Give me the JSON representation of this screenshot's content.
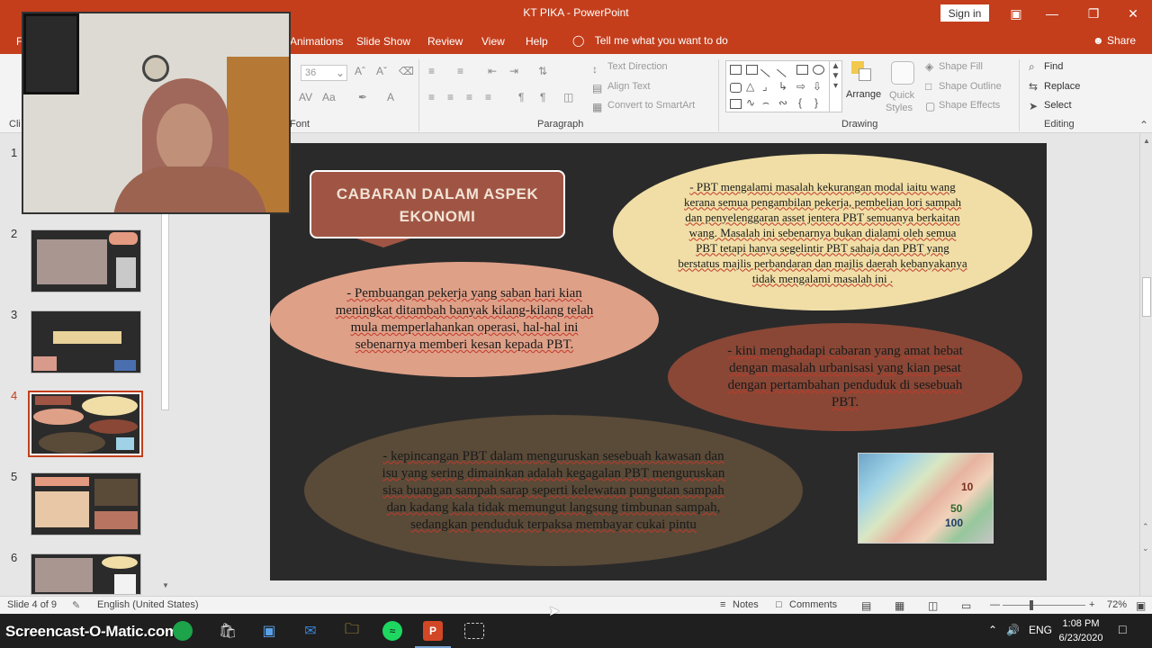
{
  "window": {
    "title": "KT PIKA  -  PowerPoint",
    "signin": "Sign in"
  },
  "tabs": {
    "file_fragment": "F",
    "animations": "Animations",
    "slideshow": "Slide Show",
    "review": "Review",
    "view": "View",
    "help": "Help",
    "tellme": "Tell me what you want to do",
    "share": "Share"
  },
  "ribbon": {
    "clipboard_fragment": "Cli",
    "font_group": "Font",
    "font_size": "36",
    "paragraph_group": "Paragraph",
    "text_direction": "Text Direction",
    "align_text": "Align Text",
    "convert_smartart": "Convert to SmartArt",
    "drawing_group": "Drawing",
    "arrange": "Arrange",
    "quick_styles_1": "Quick",
    "quick_styles_2": "Styles",
    "shape_fill": "Shape Fill",
    "shape_outline": "Shape Outline",
    "shape_effects": "Shape Effects",
    "editing_group": "Editing",
    "find": "Find",
    "replace": "Replace",
    "select": "Select"
  },
  "thumbnails": [
    {
      "num": "1"
    },
    {
      "num": "2"
    },
    {
      "num": "3"
    },
    {
      "num": "4"
    },
    {
      "num": "5"
    },
    {
      "num": "6"
    }
  ],
  "slide": {
    "title_line1": "CABARAN DALAM ASPEK",
    "title_line2": "EKONOMI",
    "bubble_top_right": "- PBT mengalami masalah kekurangan modal iaitu wang kerana semua pengambilan pekerja, pembelian lori sampah dan penyelenggaran asset jentera PBT semuanya berkaitan wang.  Masalah ini sebenarnya bukan dialami oleh semua PBT tetapi hanya  segelintir PBT  sahaja dan PBT yang berstatus majlis perbandaran dan majlis daerah  kebanyakanya tidak mengalami masalah ini .",
    "bubble_left": "- Pembuangan pekerja yang saban hari kian meningkat ditambah banyak kilang-kilang telah mula memperlahankan operasi, hal-hal ini sebenarnya memberi kesan kepada PBT.",
    "bubble_right": "-  kini menghadapi cabaran yang amat hebat dengan masalah urbanisasi yang kian pesat dengan pertambahan penduduk di sesebuah PBT.",
    "bubble_bottom": "- kepincangan PBT dalam menguruskan sesebuah kawasan dan isu yang sering dimainkan adalah kegagalan PBT menguruskan sisa buangan sampah sarap seperti kelewatan pungutan sampah dan kadang kala tidak memungut langsung timbunan sampah, sedangkan penduduk terpaksa membayar cukai pintu",
    "money_n1": "10",
    "money_n2": "50",
    "money_n3": "100"
  },
  "statusbar": {
    "slide_of": "Slide 4 of 9",
    "language": "English (United States)",
    "notes": "Notes",
    "comments": "Comments",
    "zoom": "72%"
  },
  "taskbar": {
    "watermark": "Screencast-O-Matic.com",
    "lang": "ENG",
    "time": "1:08 PM",
    "date": "6/23/2020"
  }
}
